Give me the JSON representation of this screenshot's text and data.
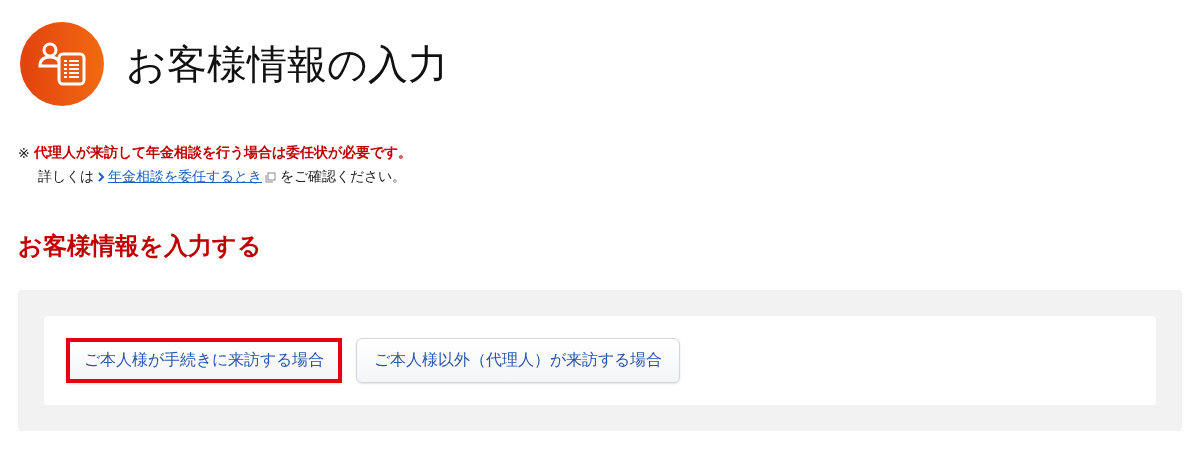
{
  "page_title": "お客様情報の入力",
  "note": {
    "mark": "※",
    "warning": "代理人が来訪して年金相談を行う場合は委任状が必要です。",
    "before": "詳しくは",
    "link": "年金相談を委任するとき",
    "after": "をご確認ください。"
  },
  "section_heading": "お客様情報を入力する",
  "options": [
    {
      "label": "ご本人様が手続きに来訪する場合",
      "selected": true
    },
    {
      "label": "ご本人様以外（代理人）が来訪する場合",
      "selected": false
    }
  ]
}
